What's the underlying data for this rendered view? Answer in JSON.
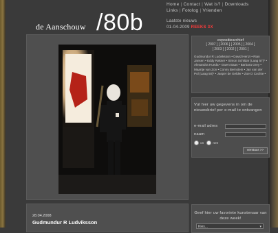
{
  "header": {
    "logo_small": "de Aanschouw",
    "logo_big": "/80b"
  },
  "nav": {
    "row1": [
      "Home",
      "Contact",
      "Wat is?",
      "Downloads"
    ],
    "row2": [
      "Links",
      "Fotolog",
      "Vrienden"
    ]
  },
  "latest": {
    "label": "Laatste nieuws",
    "date": "01-04-2009",
    "highlight": "REEKS 3X"
  },
  "sidebar": {
    "title": "expositiearchief",
    "years_row1": "[ 2007 ] [ 2006 ] [ 2005 ] [ 2004 ]",
    "years_row2": "[ 2003 ] [ 2002 ] [ 2001 ]",
    "names": "Gudmundur R Ludviksson • David Henzi • Rian Jansen • Eddy Rakser • Simon Schildar (Laag 57)* • Alexandra Hueda • Gwen Baas • Barbara Grey • Maartje van Zon • Conny Bernstein • Jan van der Pol (Laag 50)* • Jasper de Gelder • Zoe D Cochte •"
  },
  "newsletter": {
    "intro": "Vul hier uw gegevens in om de nieuwsbrief per e-mail te ontvangen",
    "email_label": "e-mail adres",
    "name_label": "naam",
    "radio_on": "on",
    "radio_off": "nee",
    "submit_label": "verstuur >>"
  },
  "post": {
    "date": "28.04.2008",
    "title": "Gudmundur R Ludviksson"
  },
  "vote": {
    "text": "Geef hier uw favoriete kunstenaar van deze week!",
    "select_value": "Kies..."
  },
  "colors": {
    "background": "#3a3a3a",
    "panel": "#4f4f4f",
    "accent": "#ff3b3b",
    "text": "#c8c8c8"
  }
}
